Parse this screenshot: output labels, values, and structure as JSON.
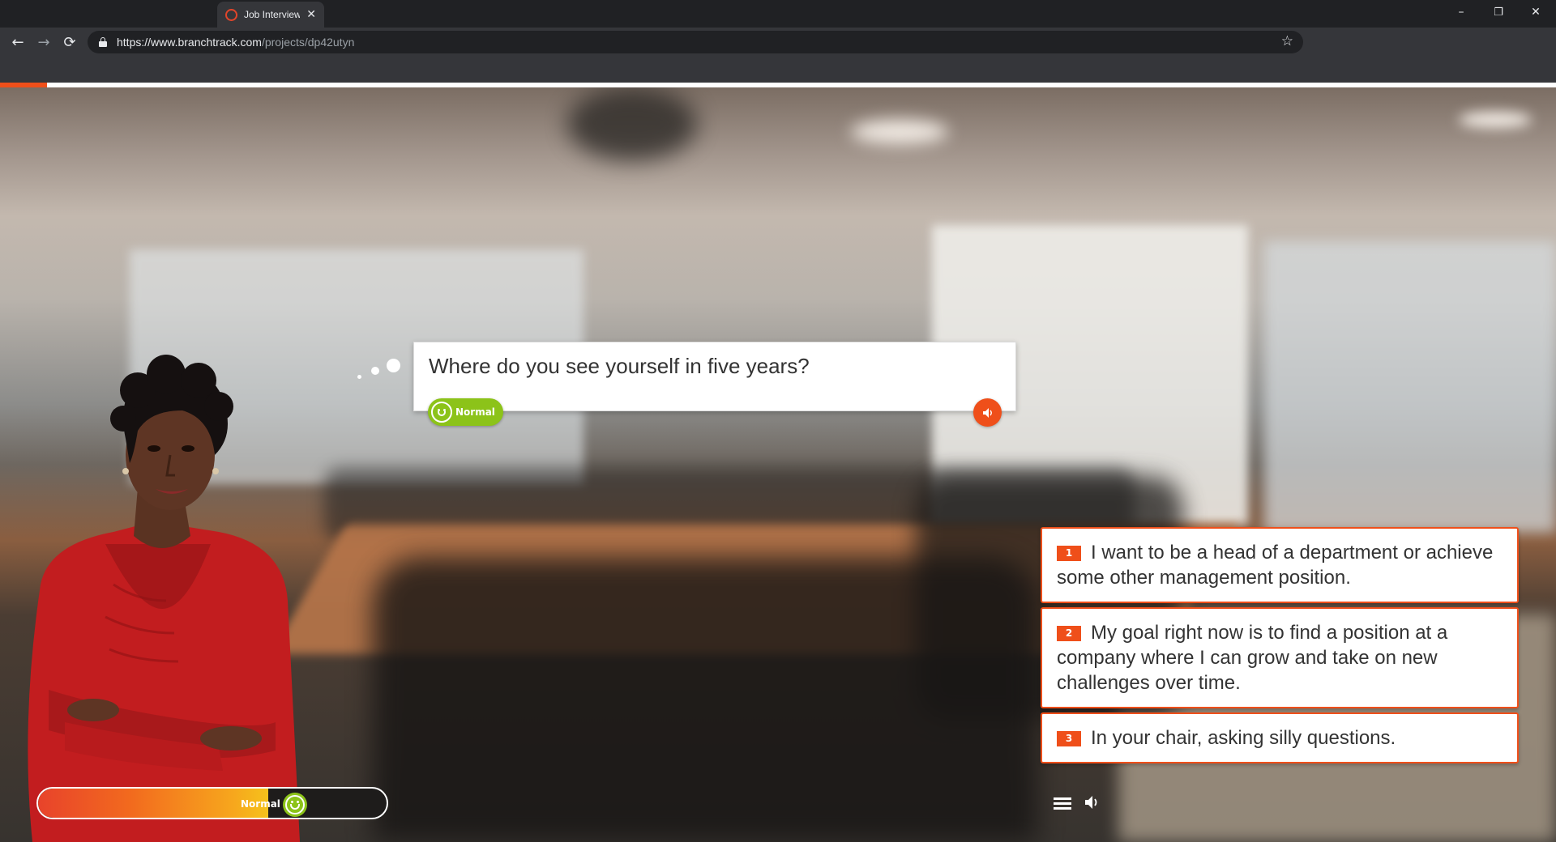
{
  "browser": {
    "tab_title": "Job Interview",
    "tab_close": "✕",
    "url_host": "https://www.branchtrack.com",
    "url_path": "/projects/dp42utyn",
    "window_min": "–",
    "window_restore": "❐",
    "window_close": "✕",
    "nav_back": "←",
    "nav_forward": "→",
    "nav_reload": "⟳",
    "bookmark": "☆"
  },
  "progress": {
    "fraction": 0.03,
    "color": "#ef4f1a"
  },
  "dialog": {
    "question": "Where do you see yourself in five years?",
    "mood_label": "Normal"
  },
  "choices": [
    {
      "number": "1",
      "text": "I want to be a head of a department or achieve some other management position."
    },
    {
      "number": "2",
      "text": "My goal right now is to find a position at a company where I can grow and take on new challenges over time."
    },
    {
      "number": "3",
      "text": "In your chair, asking silly questions."
    }
  ],
  "meter": {
    "label": "Normal",
    "fraction": 0.66
  },
  "icons": {
    "mood": "smiley-icon",
    "audio": "speaker-icon",
    "menu": "hamburger-menu-icon",
    "sound": "speaker-icon"
  },
  "colors": {
    "accent": "#ef4f1a",
    "mood_green": "#8cc319",
    "chrome_dark": "#202124",
    "chrome_mid": "#35363a"
  }
}
